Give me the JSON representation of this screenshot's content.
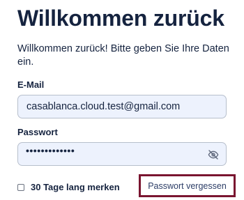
{
  "header": {
    "title": "Willkommen zurück",
    "subtitle": "Willkommen zurück! Bitte geben Sie Ihre Daten ein."
  },
  "form": {
    "email": {
      "label": "E-Mail",
      "value": "casablanca.cloud.test@gmail.com"
    },
    "password": {
      "label": "Passwort",
      "masked_value": "•••••••••••••",
      "toggle_icon": "eye-slash-icon"
    },
    "remember": {
      "label": "30 Tage lang merken",
      "checked": false
    },
    "forgot_password": {
      "label": "Passwort vergessen",
      "highlight_color": "#7a1530"
    }
  },
  "colors": {
    "text": "#15233f",
    "field_background": "#edf2fd",
    "field_border": "#b7bfcc",
    "link": "#2c3d66"
  }
}
